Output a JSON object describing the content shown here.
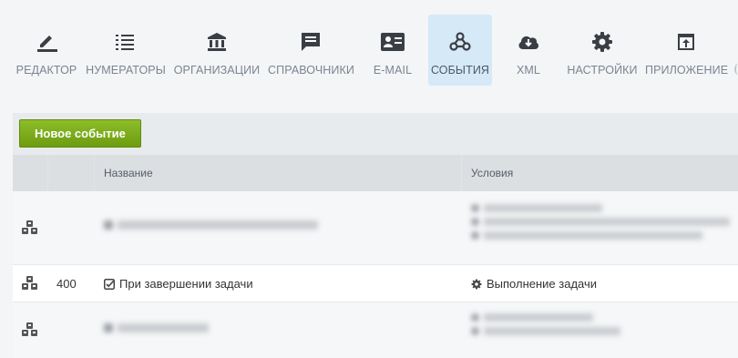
{
  "toolbar": {
    "items": [
      {
        "label": "РЕДАКТОР",
        "icon": "pencil-icon"
      },
      {
        "label": "НУМЕРАТОРЫ",
        "icon": "numbered-list-icon"
      },
      {
        "label": "ОРГАНИЗАЦИИ",
        "icon": "bank-icon"
      },
      {
        "label": "СПРАВОЧНИКИ",
        "icon": "message-icon"
      },
      {
        "label": "E-MAIL",
        "icon": "contact-card-icon"
      },
      {
        "label": "СОБЫТИЯ",
        "icon": "webhook-icon",
        "active": true
      },
      {
        "label": "XML",
        "icon": "cloud-download-icon"
      },
      {
        "label": "НАСТРОЙКИ",
        "icon": "gear-icon"
      },
      {
        "label": "ПРИЛОЖЕНИЕ",
        "icon": "upload-window-icon"
      }
    ],
    "active_color": "#d6e9f6"
  },
  "panel": {
    "new_event_button": "Новое событие",
    "columns": {
      "name": "Название",
      "conditions": "Условия"
    }
  },
  "rows": [
    {
      "id": "",
      "name": "",
      "conditions": [
        "",
        "",
        ""
      ],
      "blurred": true
    },
    {
      "id": "400",
      "name": "При завершении задачи",
      "conditions": [
        "Выполнение задачи"
      ],
      "blurred": false
    },
    {
      "id": "",
      "name": "",
      "conditions": [
        "",
        ""
      ],
      "blurred": true
    }
  ],
  "colors": {
    "button_green": "#7aab1a",
    "header_bg": "#dcdfe2",
    "icon_dark": "#3a3f45"
  }
}
